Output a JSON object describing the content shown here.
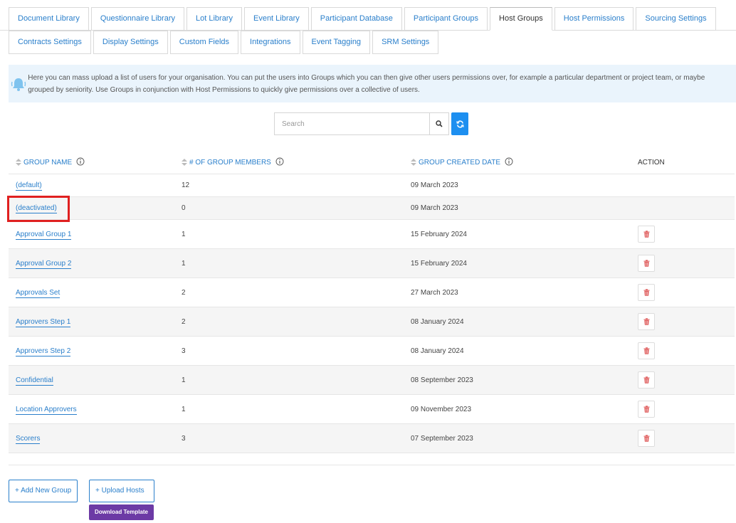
{
  "tabs_row1": [
    {
      "label": "Document Library",
      "active": false
    },
    {
      "label": "Questionnaire Library",
      "active": false
    },
    {
      "label": "Lot Library",
      "active": false
    },
    {
      "label": "Event Library",
      "active": false
    },
    {
      "label": "Participant Database",
      "active": false
    },
    {
      "label": "Participant Groups",
      "active": false
    },
    {
      "label": "Host Groups",
      "active": true
    },
    {
      "label": "Host Permissions",
      "active": false
    },
    {
      "label": "Sourcing Settings",
      "active": false
    }
  ],
  "tabs_row2": [
    {
      "label": "Contracts Settings"
    },
    {
      "label": "Display Settings"
    },
    {
      "label": "Custom Fields"
    },
    {
      "label": "Integrations"
    },
    {
      "label": "Event Tagging"
    },
    {
      "label": "SRM Settings"
    }
  ],
  "info": {
    "text": "Here you can mass upload a list of users for your organisation. You can put the users into Groups which you can then give other users permissions over, for example a particular department or project team, or maybe grouped by seniority. Use Groups in conjunction with Host Permissions to quickly give permissions over a collective of users."
  },
  "search": {
    "placeholder": "Search",
    "value": ""
  },
  "table": {
    "headers": {
      "group_name": "GROUP NAME",
      "members": "# OF GROUP MEMBERS",
      "created": "GROUP CREATED DATE",
      "action": "ACTION"
    },
    "rows": [
      {
        "name": "(default)",
        "members": "12",
        "created": "09 March 2023",
        "deletable": false
      },
      {
        "name": "(deactivated)",
        "members": "0",
        "created": "09 March 2023",
        "deletable": false
      },
      {
        "name": "Approval Group 1",
        "members": "1",
        "created": "15 February 2024",
        "deletable": true
      },
      {
        "name": "Approval Group 2",
        "members": "1",
        "created": "15 February 2024",
        "deletable": true
      },
      {
        "name": "Approvals Set",
        "members": "2",
        "created": "27 March 2023",
        "deletable": true
      },
      {
        "name": "Approvers Step 1",
        "members": "2",
        "created": "08 January 2024",
        "deletable": true
      },
      {
        "name": "Approvers Step 2",
        "members": "3",
        "created": "08 January 2024",
        "deletable": true
      },
      {
        "name": "Confidential",
        "members": "1",
        "created": "08 September 2023",
        "deletable": true
      },
      {
        "name": "Location Approvers",
        "members": "1",
        "created": "09 November 2023",
        "deletable": true
      },
      {
        "name": "Scorers",
        "members": "3",
        "created": "07 September 2023",
        "deletable": true
      }
    ]
  },
  "buttons": {
    "add_group": "+ Add New Group",
    "upload_hosts": "+ Upload Hosts",
    "download_template": "Download Template"
  },
  "colors": {
    "link": "#2a7fcb",
    "refresh": "#1d8ff0",
    "download": "#6c3aa5",
    "highlight": "#e02020",
    "trash": "#e06060"
  }
}
